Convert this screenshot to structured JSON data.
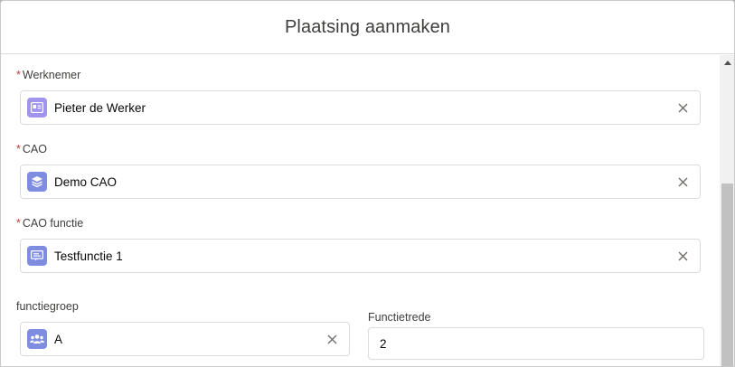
{
  "modal": {
    "title": "Plaatsing aanmaken"
  },
  "form": {
    "required_marker": "*",
    "werknemer": {
      "label": "Werknemer",
      "value": "Pieter de Werker",
      "icon": "contact-card-icon",
      "icon_color": "#a094ed"
    },
    "cao": {
      "label": "CAO",
      "value": "Demo CAO",
      "icon": "layers-icon",
      "icon_color": "#7f8de1"
    },
    "cao_functie": {
      "label": "CAO functie",
      "value": "Testfunctie 1",
      "icon": "document-icon",
      "icon_color": "#7f8de1"
    },
    "functiegroep": {
      "label": "functiegroep",
      "value": "A",
      "icon": "group-icon",
      "icon_color": "#7f8de1"
    },
    "functietrede": {
      "label": "Functietrede",
      "value": "2"
    }
  },
  "colors": {
    "required": "#c23934",
    "border": "#dddbda"
  }
}
